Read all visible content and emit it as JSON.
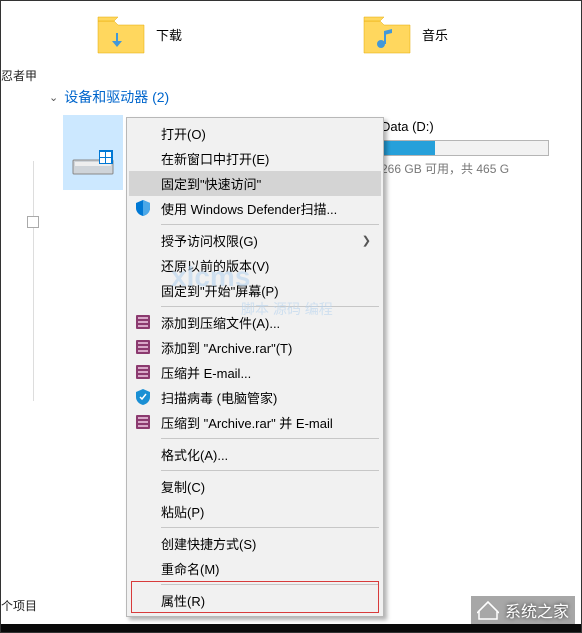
{
  "folders": {
    "downloads": {
      "label": "下载"
    },
    "music": {
      "label": "音乐"
    }
  },
  "leftLabel": "忍者甲",
  "section": {
    "title": "设备和驱动器 (2)"
  },
  "driveD": {
    "label": "Data (D:)",
    "stats": "266 GB 可用，共 465 G"
  },
  "menu": {
    "open": "打开(O)",
    "openNewWindow": "在新窗口中打开(E)",
    "pinQuickAccess": "固定到\"快速访问\"",
    "defender": "使用 Windows Defender扫描...",
    "grantAccess": "授予访问权限(G)",
    "restorePrev": "还原以前的版本(V)",
    "pinStart": "固定到\"开始\"屏幕(P)",
    "addArchive": "添加到压缩文件(A)...",
    "addArchiveRar": "添加到 \"Archive.rar\"(T)",
    "compressEmail": "压缩并 E-mail...",
    "scanVirus": "扫描病毒 (电脑管家)",
    "compressRarEmail": "压缩到 \"Archive.rar\" 并 E-mail",
    "format": "格式化(A)...",
    "copy": "复制(C)",
    "paste": "粘贴(P)",
    "createShortcut": "创建快捷方式(S)",
    "rename": "重命名(M)",
    "properties": "属性(R)"
  },
  "watermark": {
    "main": "xlcms",
    "sub": "脚本 源码 编程"
  },
  "bottomLabel": "个项目",
  "bottomWatermark": "系统之家"
}
